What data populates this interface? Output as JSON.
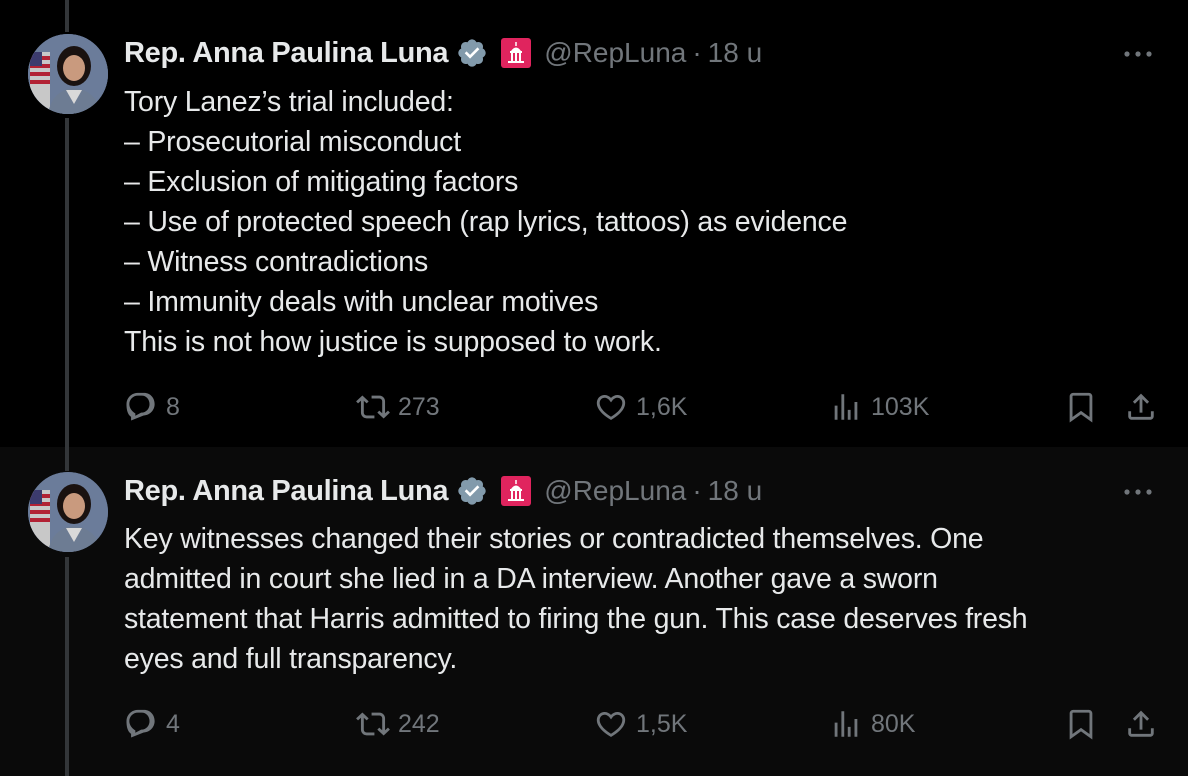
{
  "colors": {
    "background": "#000000",
    "text": "#e7e9ea",
    "secondary": "#71767b",
    "verified": "#829aab",
    "gov_badge": "#e0245e"
  },
  "tweets": [
    {
      "author": {
        "display_name": "Rep. Anna Paulina Luna",
        "handle": "@RepLuna",
        "separator": "·",
        "time": "18 u"
      },
      "lines": [
        "Tory Lanez’s trial included:",
        "– Prosecutorial misconduct",
        "– Exclusion of mitigating factors",
        "– Use of protected speech (rap lyrics, tattoos) as evidence",
        "– Witness contradictions",
        "– Immunity deals with unclear motives",
        "This is not how justice is supposed to work."
      ],
      "stats": {
        "replies": "8",
        "reposts": "273",
        "likes": "1,6K",
        "views": "103K"
      }
    },
    {
      "author": {
        "display_name": "Rep. Anna Paulina Luna",
        "handle": "@RepLuna",
        "separator": "·",
        "time": "18 u"
      },
      "lines": [
        "Key witnesses changed their stories or contradicted themselves. One",
        "admitted in court she lied in a DA interview. Another gave a sworn",
        "statement that Harris admitted to firing the gun. This case deserves fresh",
        "eyes and full transparency."
      ],
      "stats": {
        "replies": "4",
        "reposts": "242",
        "likes": "1,5K",
        "views": "80K"
      }
    }
  ]
}
